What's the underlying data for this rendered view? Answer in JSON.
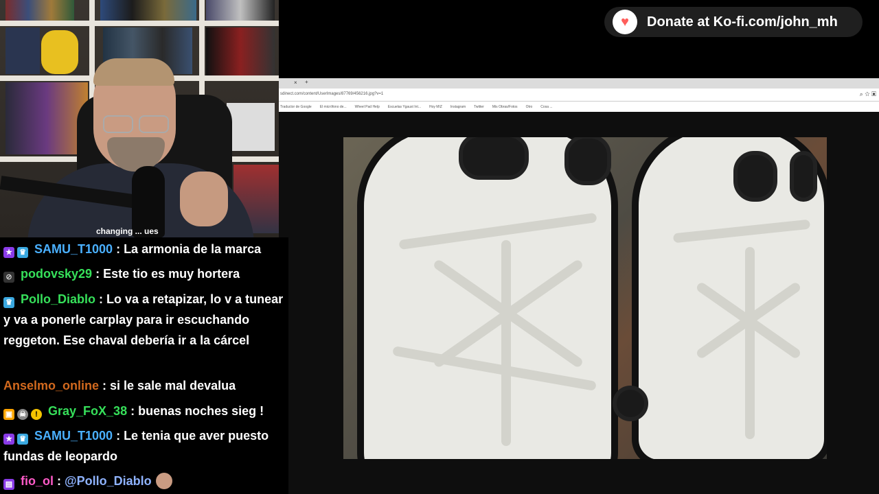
{
  "kofi": {
    "label": "Donate at Ko-fi.com/john_mh",
    "icon": "kofi-cup-icon"
  },
  "webcam": {
    "shirt_text": "changing ... ues"
  },
  "browser": {
    "tab_close": "×",
    "tab_new": "+",
    "url": "sdinect.com/content/UserImages/87769/456216.jpg?v=1",
    "bookmarks": [
      "Traductor de Google",
      "El micrófono de...",
      "Wheel Pad Help",
      "Escuelas Ygaust Int...",
      "Hoy MIZ",
      "Instagram",
      "Twitter",
      "Mis Obras/Fotos",
      "Otro",
      "Cosa ..."
    ]
  },
  "chat": {
    "messages": [
      {
        "user": "SAMU_T1000",
        "text": "La armonia de la marca",
        "badges": [
          "prime-star-icon",
          "crown-subscriber-icon"
        ]
      },
      {
        "user": "podovsky29",
        "text": "Este tio es muy hortera",
        "badges": [
          "no-audio-icon"
        ]
      },
      {
        "user": "Pollo_Diablo",
        "text": "Lo va a retapizar, lo v a tunear y va a ponerle carplay para ir escuchando reggeton. Ese chaval debería ir a la cárcel",
        "badges": [
          "crown-subscriber-icon"
        ]
      },
      {
        "user": "Anselmo_online",
        "text": "si le sale mal devalua",
        "badges": []
      },
      {
        "user": "Gray_FoX_38",
        "text": "buenas noches sieg !",
        "badges": [
          "box-icon",
          "skull-icon",
          "exclamation-icon"
        ]
      },
      {
        "user": "SAMU_T1000",
        "text": "Le tenia que aver puesto fundas de leopardo",
        "badges": [
          "prime-star-icon",
          "crown-subscriber-icon"
        ]
      },
      {
        "user": "fio_ol",
        "text": "@Pollo_Diablo",
        "badges": [
          "subscriber-icon"
        ],
        "emote": "face-emote-icon"
      }
    ]
  },
  "colors": {
    "kofi_heart": "#ff5e5b",
    "samu": "#4ab0ff",
    "green_users": "#36e05a",
    "anselmo": "#d2691e",
    "fio": "#ff5ac8"
  }
}
